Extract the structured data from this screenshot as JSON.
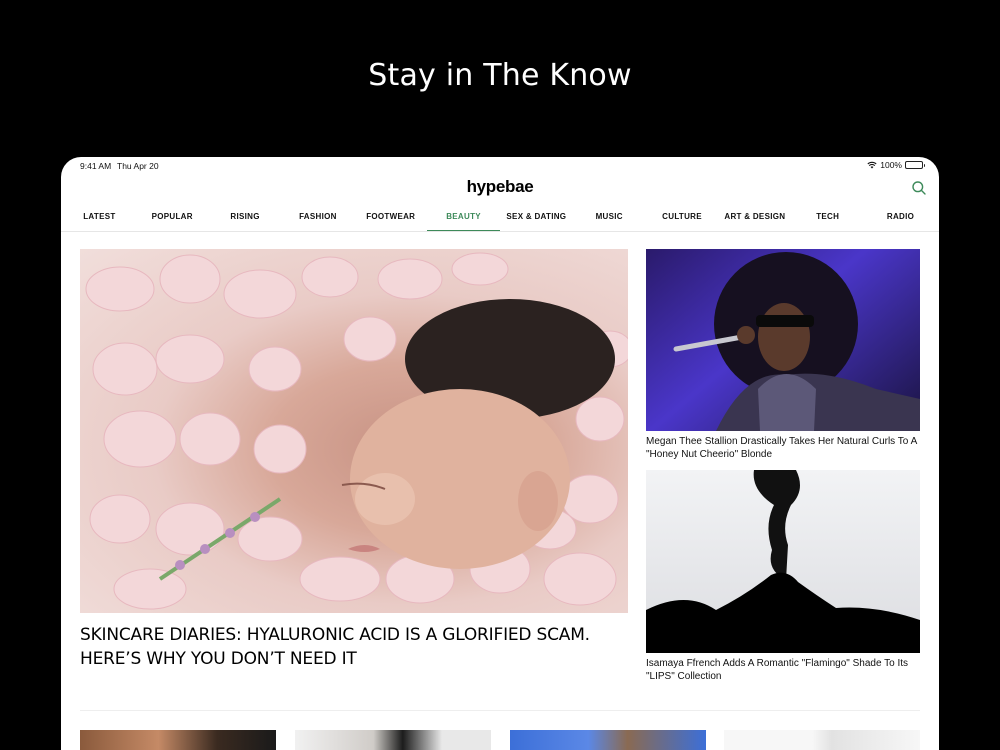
{
  "promo": {
    "headline": "Stay in The Know"
  },
  "status_bar": {
    "time": "9:41 AM",
    "date": "Thu Apr 20",
    "battery": "100%"
  },
  "app": {
    "logo": "hypebae",
    "search_icon": "search-icon"
  },
  "nav": {
    "active_index": 5,
    "items": [
      {
        "label": "LATEST"
      },
      {
        "label": "POPULAR"
      },
      {
        "label": "RISING"
      },
      {
        "label": "FASHION"
      },
      {
        "label": "FOOTWEAR"
      },
      {
        "label": "BEAUTY"
      },
      {
        "label": "SEX & DATING"
      },
      {
        "label": "MUSIC"
      },
      {
        "label": "CULTURE"
      },
      {
        "label": "ART & DESIGN"
      },
      {
        "label": "TECH"
      },
      {
        "label": "RADIO"
      }
    ]
  },
  "hero": {
    "headline": "SKINCARE DIARIES: HYALURONIC ACID IS A GLORIFIED SCAM. HERE’S WHY YOU DON’T NEED IT"
  },
  "side_articles": [
    {
      "title": "Megan Thee Stallion Drastically Takes Her Natural Curls To A \"Honey Nut Cheerio\" Blonde"
    },
    {
      "title": "Isamaya Ffrench Adds A Romantic \"Flamingo\" Shade To Its \"LIPS\" Collection"
    }
  ],
  "colors": {
    "accent": "#3d8a5a",
    "background": "#000000",
    "surface": "#ffffff"
  }
}
